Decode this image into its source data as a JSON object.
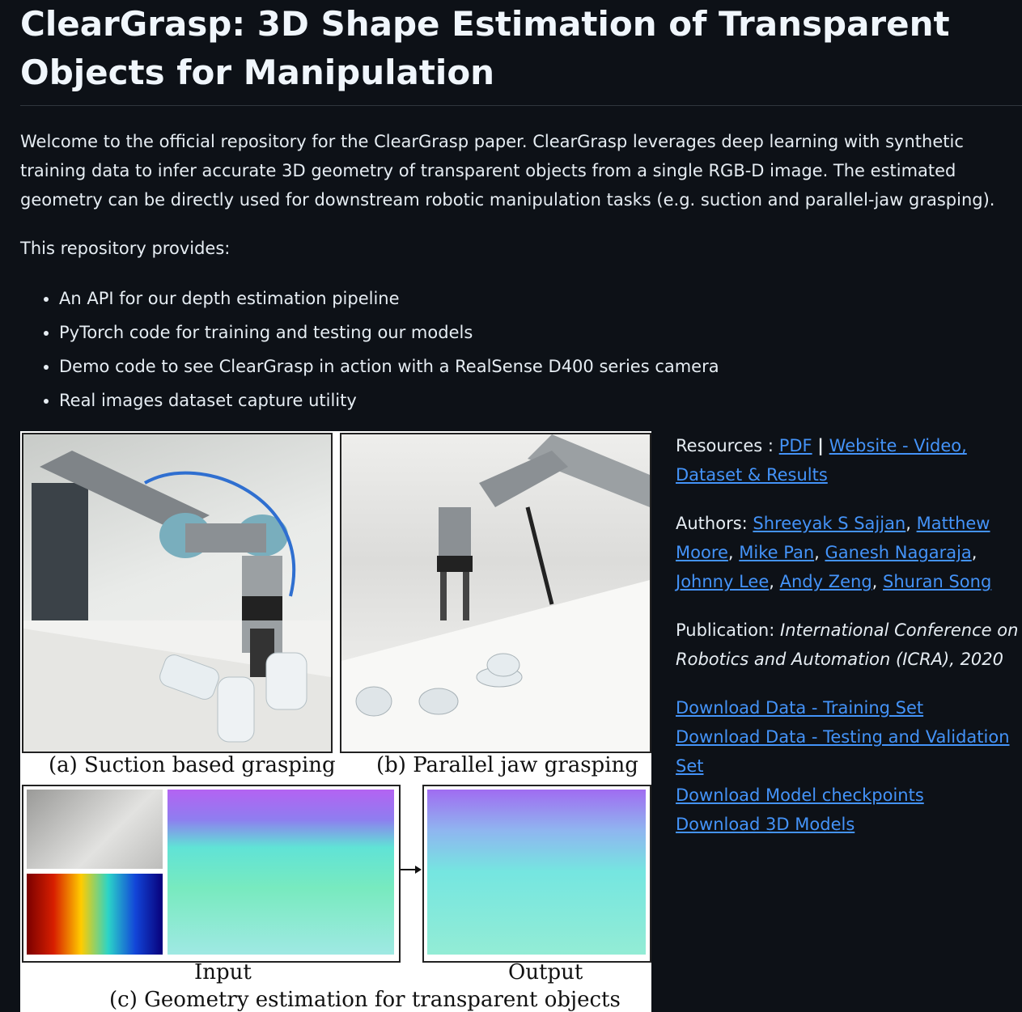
{
  "title": "ClearGrasp: 3D Shape Estimation of Transparent Objects for Manipulation",
  "intro": "Welcome to the official repository for the ClearGrasp paper. ClearGrasp leverages deep learning with synthetic training data to infer accurate 3D geometry of transparent objects from a single RGB-D image. The estimated geometry can be directly used for downstream robotic manipulation tasks (e.g. suction and parallel-jaw grasping).",
  "provides_heading": "This repository provides:",
  "features": [
    "An API for our depth estimation pipeline",
    "PyTorch code for training and testing our models",
    "Demo code to see ClearGrasp in action with a RealSense D400 series camera",
    "Real images dataset capture utility"
  ],
  "figure": {
    "caption_a": "(a) Suction based grasping",
    "caption_b": "(b) Parallel jaw grasping",
    "label_input": "Input",
    "label_output": "Output",
    "caption_c": "(c) Geometry estimation for transparent objects"
  },
  "resources": {
    "label": "Resources :",
    "pdf": "PDF",
    "separator": "|",
    "website": "Website - Video, Dataset & Results"
  },
  "authors": {
    "label": "Authors:",
    "names": [
      "Shreeyak S Sajjan",
      "Matthew Moore",
      "Mike Pan",
      "Ganesh Nagaraja",
      "Johnny Lee",
      "Andy Zeng",
      "Shuran Song"
    ]
  },
  "publication": {
    "label": "Publication:",
    "venue": "International Conference on Robotics and Automation (ICRA), 2020"
  },
  "downloads": [
    "Download Data - Training Set",
    "Download Data - Testing and Validation Set",
    "Download Model checkpoints",
    "Download 3D Models"
  ],
  "colors": {
    "background": "#0d1117",
    "text": "#e6edf3",
    "link": "#4493f8"
  }
}
